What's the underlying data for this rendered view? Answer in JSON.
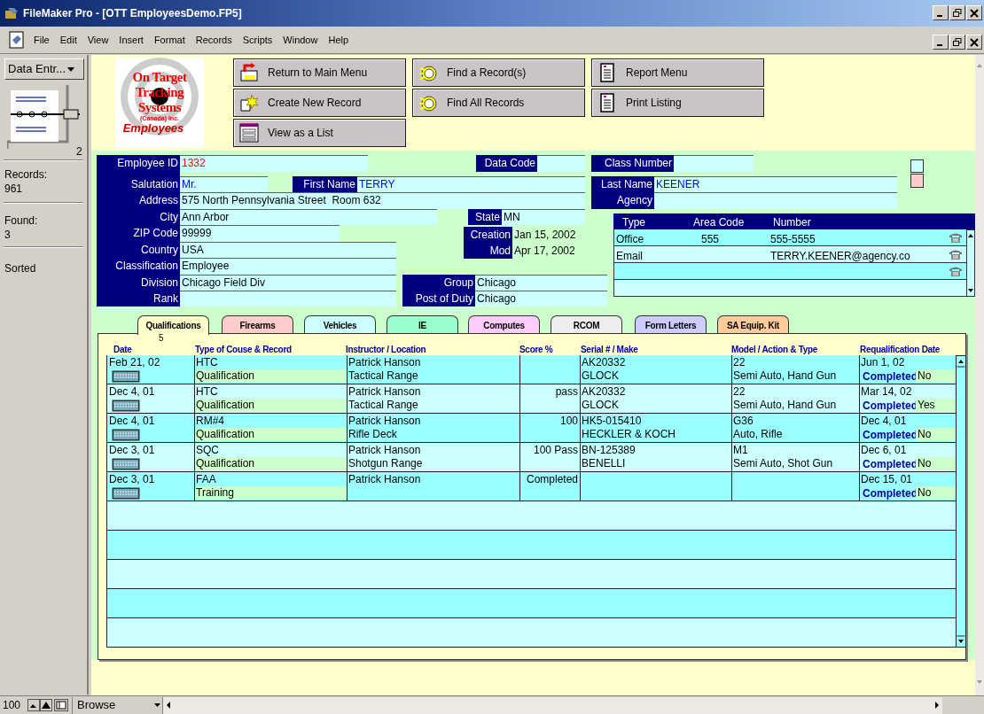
{
  "window": {
    "title": "FileMaker Pro - [OTT EmployeesDemo.FP5]"
  },
  "menu": [
    "File",
    "Edit",
    "View",
    "Insert",
    "Format",
    "Records",
    "Scripts",
    "Window",
    "Help"
  ],
  "status_area": {
    "layout": "Data Entr...",
    "record_number": "2",
    "records_label": "Records:",
    "records_count": "961",
    "found_label": "Found:",
    "found_count": "3",
    "sort_state": "Sorted"
  },
  "logo": {
    "lines": [
      "On Target",
      "Tracking",
      "Systems"
    ],
    "subtitle": "(Canada) Inc.",
    "caption": "Employees"
  },
  "buttons": [
    {
      "label": "Return to Main Menu",
      "kind": "return"
    },
    {
      "label": "Find a Record(s)",
      "kind": "find"
    },
    {
      "label": "Report Menu",
      "kind": "report"
    },
    {
      "label": "Create New Record",
      "kind": "new"
    },
    {
      "label": "Find All Records",
      "kind": "find"
    },
    {
      "label": "Print Listing",
      "kind": "report"
    },
    {
      "label": "View as a List",
      "kind": "list"
    }
  ],
  "fields": [
    {
      "label": "Employee ID",
      "value": "1332",
      "kind": "entry",
      "color": "#ff0000"
    },
    {
      "label": "Data Code",
      "kind": "entry"
    },
    {
      "label": "Class Number",
      "kind": "entry"
    },
    {
      "label": "Salutation",
      "value": "Mr.",
      "kind": "entry",
      "color": "#0000ff"
    },
    {
      "label": "First Name",
      "value": "TERRY",
      "kind": "entry",
      "color": "#0000ff"
    },
    {
      "label": "Last Name",
      "value": "KEENER",
      "kind": "entry",
      "color": "#0000ff"
    },
    {
      "label": "Address",
      "value": "575 North Pennsylvania Street  Room 632",
      "kind": "entry",
      "color": "#000000"
    },
    {
      "label": "Agency",
      "kind": "entry"
    },
    {
      "label": "City",
      "value": "Ann Arbor",
      "kind": "entry",
      "color": "#000000"
    },
    {
      "label": "State",
      "value": "MN",
      "kind": "entry",
      "color": "#000000"
    },
    {
      "label": "ZIP Code",
      "value": "99999",
      "kind": "entry",
      "color": "#000000"
    },
    {
      "label": "Creation",
      "value": "Jan 15, 2002",
      "kind": "stamp",
      "color": "#000000"
    },
    {
      "label": "Country",
      "value": "USA",
      "kind": "entry",
      "color": "#000000"
    },
    {
      "label": "Mod",
      "value": "Apr 17, 2002",
      "kind": "stamp",
      "color": "#000000"
    },
    {
      "label": "Classification",
      "value": "Employee",
      "kind": "entry",
      "color": "#000000"
    },
    {
      "label": "Division",
      "value": "Chicago Field Div",
      "kind": "entry",
      "color": "#000000"
    },
    {
      "label": "Group",
      "value": "Chicago",
      "kind": "entry",
      "color": "#000000"
    },
    {
      "label": "Rank",
      "kind": "entry"
    },
    {
      "label": "Post of Duty",
      "value": "Chicago",
      "kind": "entry",
      "color": "#000000"
    }
  ],
  "phones": {
    "columns": [
      "Type",
      "Area Code",
      "Number"
    ],
    "rows": [
      {
        "type": "Office",
        "area_code": "555",
        "number": "555-5555"
      },
      {
        "type": "Email",
        "number": "TERRY.KEENER@agency.co"
      },
      {}
    ]
  },
  "tabs": [
    {
      "label": "Qualifications",
      "color": "#ffffcc",
      "selected": true,
      "count": "5"
    },
    {
      "label": "Firearms",
      "color": "#ffcccc",
      "selected": false
    },
    {
      "label": "Vehicles",
      "color": "#ccffff",
      "selected": false
    },
    {
      "label": "IE",
      "color": "#99ffcc",
      "selected": false
    },
    {
      "label": "Computes",
      "color": "#ffccff",
      "selected": false
    },
    {
      "label": "RCOM",
      "color": "#eeeeee",
      "selected": false
    },
    {
      "label": "Form Letters",
      "color": "#ccccff",
      "selected": false
    },
    {
      "label": "SA Equip. Kit",
      "color": "#ffcc99",
      "selected": false
    }
  ],
  "records": {
    "columns": [
      "Date",
      "Type of Couse & Record",
      "Instructor / Location",
      "Score %",
      "Serial # / Make",
      "Model / Action & Type",
      "Requalification Date"
    ],
    "rows": [
      {
        "date": "Feb 21, 02",
        "course": "HTC",
        "record_type": "Qualification",
        "instructor": "Patrick Hanson",
        "location": "Tactical Range",
        "serial": "AK20332",
        "make": "GLOCK",
        "model": "22",
        "action_type": "Semi Auto, Hand Gun",
        "requal_date": "Jun 1, 02",
        "completed_label": "Completed",
        "completed": "No"
      },
      {
        "date": "Dec 4, 01",
        "course": "HTC",
        "record_type": "Qualification",
        "instructor": "Patrick Hanson",
        "location": "Tactical Range",
        "score": "pass",
        "serial": "AK20332",
        "make": "GLOCK",
        "model": "22",
        "action_type": "Semi Auto, Hand Gun",
        "requal_date": "Mar 14, 02",
        "completed_label": "Completed",
        "completed": "Yes"
      },
      {
        "date": "Dec 4, 01",
        "course": "RM#4",
        "record_type": "Qualification",
        "instructor": "Patrick Hanson",
        "location": "Rifle Deck",
        "score": "100",
        "serial": "HK5-015410",
        "make": "HECKLER & KOCH",
        "model": "G36",
        "action_type": "Auto, Rifle",
        "requal_date": "Dec 4, 01",
        "completed_label": "Completed",
        "completed": "No"
      },
      {
        "date": "Dec 3, 01",
        "course": "SQC",
        "record_type": "Qualification",
        "instructor": "Patrick Hanson",
        "location": "Shotgun Range",
        "score": "100 Pass",
        "serial": "BN-125389",
        "make": "BENELLI",
        "model": "M1",
        "action_type": "Semi Auto, Shot Gun",
        "requal_date": "Dec 6, 01",
        "completed_label": "Completed",
        "completed": "No"
      },
      {
        "date": "Dec 3, 01",
        "course": "FAA",
        "record_type": "Training",
        "instructor": "Patrick Hanson",
        "score": "Completed",
        "requal_date": "Dec 15, 01",
        "completed_label": "Completed",
        "completed": "No"
      }
    ]
  },
  "status_bar": {
    "zoom": "100",
    "mode": "Browse"
  }
}
